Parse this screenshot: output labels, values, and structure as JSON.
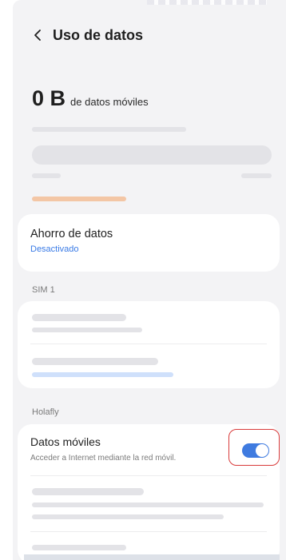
{
  "header": {
    "title": "Uso de datos",
    "back_icon": "chevron-left-icon"
  },
  "usage": {
    "amount": "0 B",
    "label": "de datos móviles"
  },
  "data_saver": {
    "title": "Ahorro de datos",
    "status": "Desactivado"
  },
  "sections": {
    "sim": "SIM 1",
    "carrier": "Holafly"
  },
  "mobile_data": {
    "title": "Datos móviles",
    "subtitle": "Acceder a Internet mediante la red móvil.",
    "enabled": true
  },
  "colors": {
    "accent": "#3f7be0",
    "highlight": "#d93b3b",
    "usage_bar": "#f3c6a5",
    "sim_bar": "#cfe0fb"
  }
}
